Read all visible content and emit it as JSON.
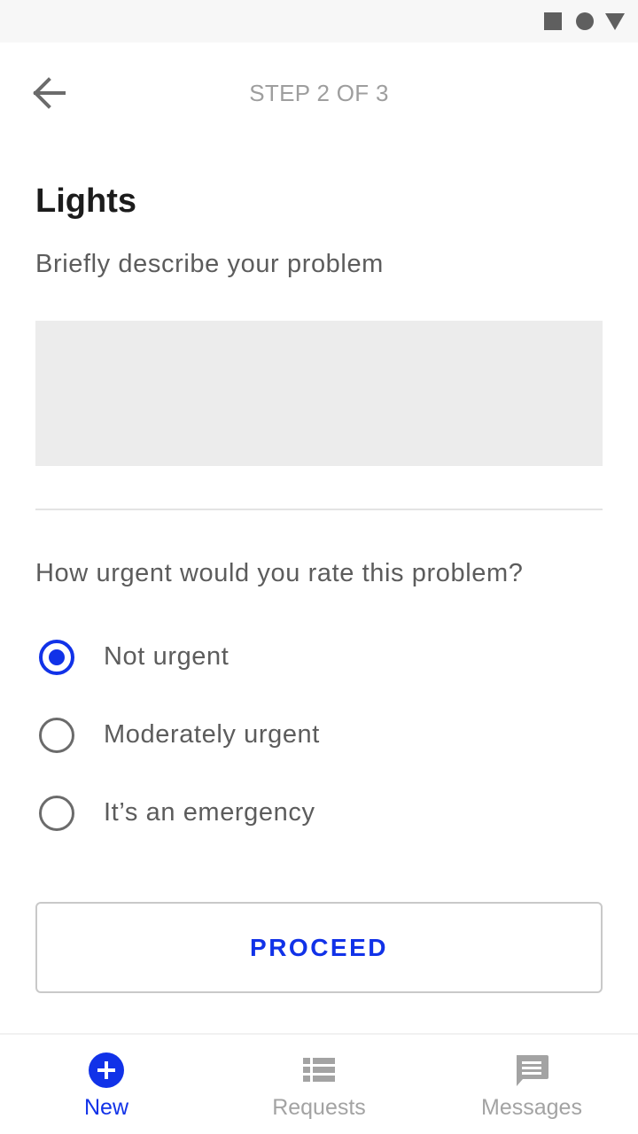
{
  "header": {
    "step_label": "STEP 2 OF 3"
  },
  "form": {
    "title": "Lights",
    "subtitle": "Briefly describe your problem",
    "description_value": "",
    "description_placeholder": "",
    "question": "How urgent would you rate this problem?",
    "urgency_options": [
      {
        "label": "Not urgent",
        "selected": true
      },
      {
        "label": "Moderately urgent",
        "selected": false
      },
      {
        "label": "It’s an emergency",
        "selected": false
      }
    ],
    "proceed_label": "PROCEED"
  },
  "bottom_nav": {
    "items": [
      {
        "label": "New",
        "icon": "add-circle-icon",
        "active": true
      },
      {
        "label": "Requests",
        "icon": "list-icon",
        "active": false
      },
      {
        "label": "Messages",
        "icon": "message-icon",
        "active": false
      }
    ]
  },
  "colors": {
    "accent": "#1132e8",
    "text_secondary": "#5c5c5c",
    "inactive": "#a3a3a3",
    "input_bg": "#ececec"
  }
}
